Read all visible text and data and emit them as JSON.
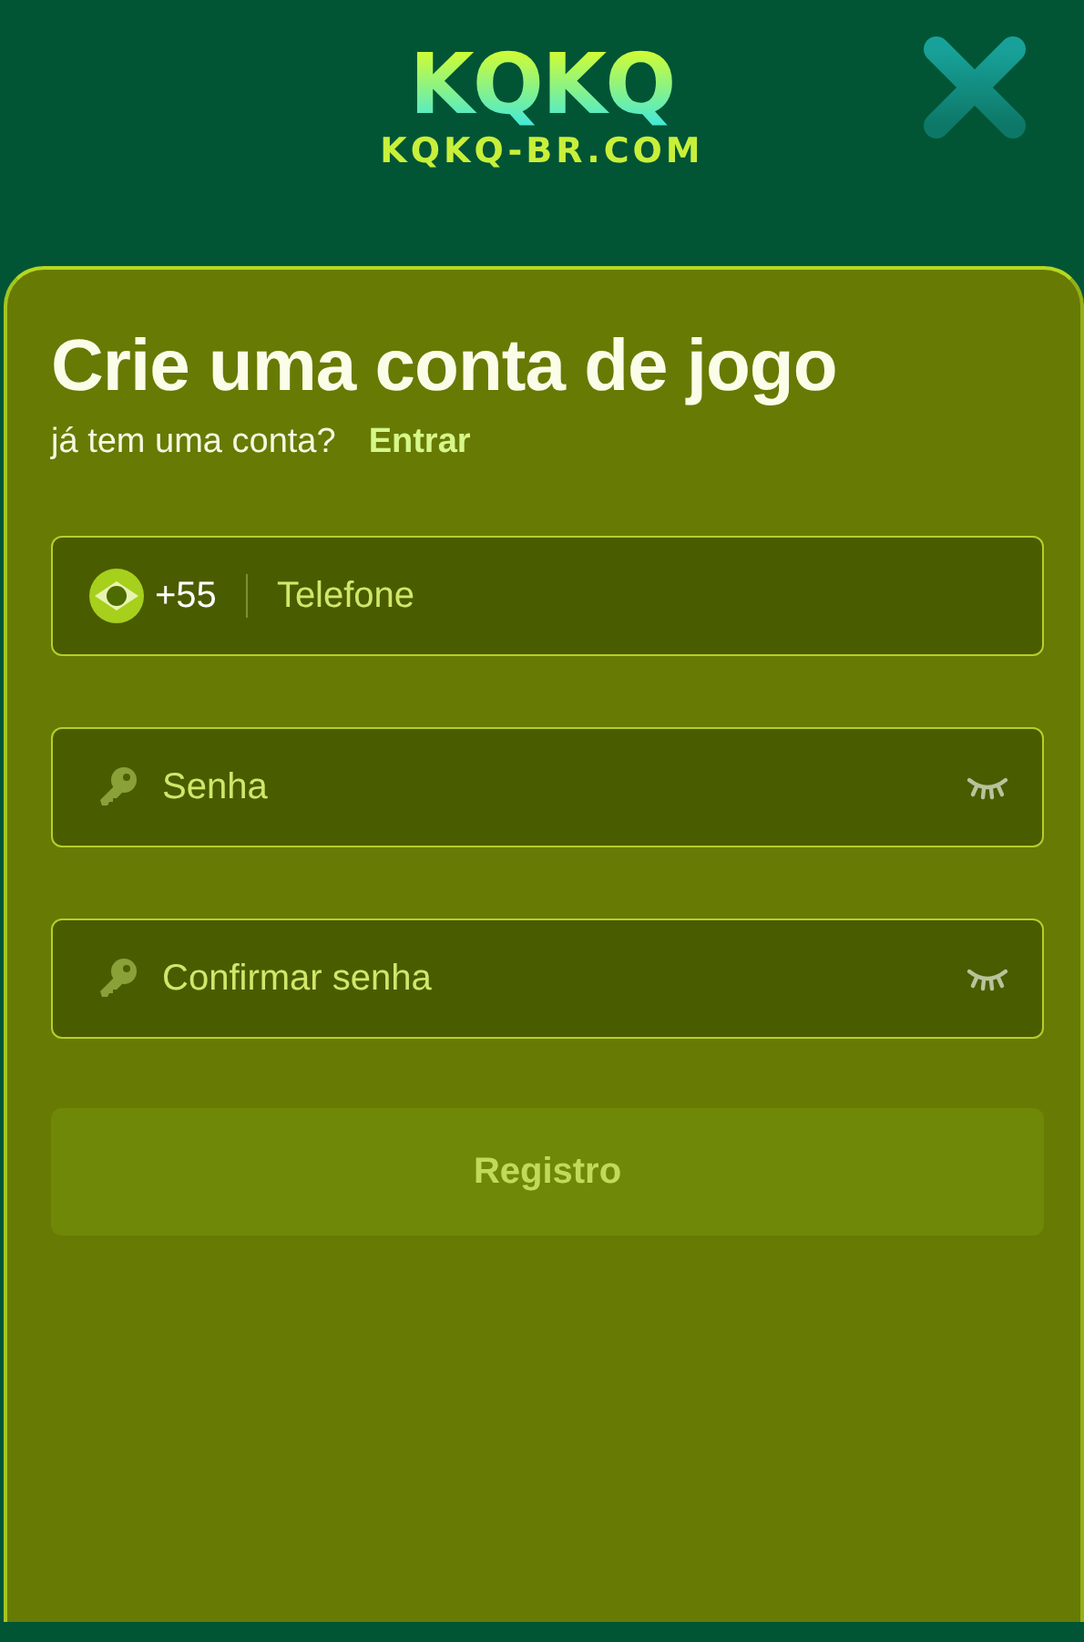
{
  "header": {
    "logo": "KQKQ",
    "domain": "KQKQ-BR.COM"
  },
  "form": {
    "title": "Crie uma conta de jogo",
    "prompt": "já tem uma conta?",
    "login_link": "Entrar",
    "fields": [
      {
        "kind": "phone",
        "prefix": "+55",
        "placeholder": "Telefone"
      },
      {
        "kind": "password",
        "placeholder": "Senha"
      },
      {
        "kind": "password",
        "placeholder": "Confirmar senha"
      }
    ],
    "submit": {
      "label": "Registro",
      "disabled": true
    }
  }
}
